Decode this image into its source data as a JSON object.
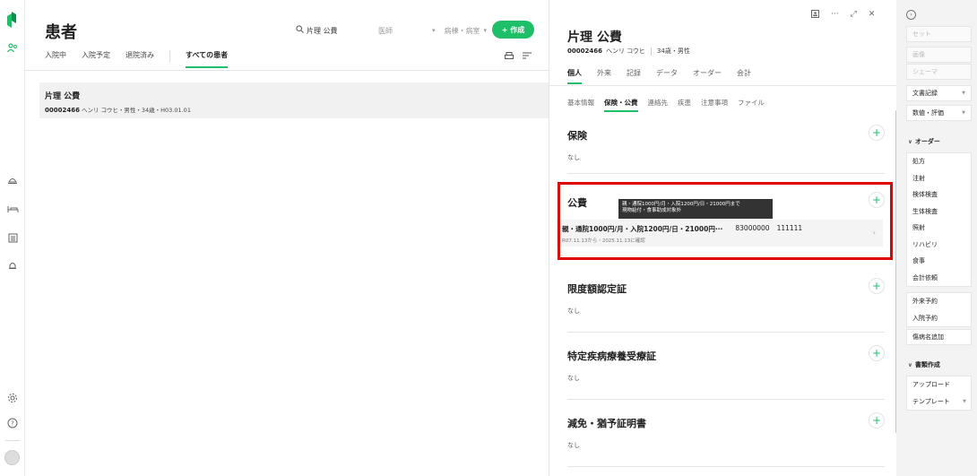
{
  "list": {
    "title": "患者",
    "search": {
      "query": "片理 公費",
      "filter_doctor": "医師",
      "filter_ward": "病棟・病室"
    },
    "create_label": "+ 作成",
    "tabs": [
      "入院中",
      "入院予定",
      "退院済み",
      "すべての患者"
    ],
    "active_tab": 3,
    "patient": {
      "name": "片理 公費",
      "id": "00002466",
      "meta": "ヘンリ コウヒ・男性・34歳・H03.01.01"
    }
  },
  "detail": {
    "name": "片理 公費",
    "id": "00002466",
    "kana": "ヘンリ コウヒ",
    "age_sex": "34歳・男性",
    "tabs": [
      "個人",
      "外来",
      "記録",
      "データ",
      "オーダー",
      "会計"
    ],
    "subtabs": [
      "基本情報",
      "保険・公費",
      "連絡先",
      "疾患",
      "注意事項",
      "ファイル"
    ],
    "sections": {
      "insurance": {
        "title": "保険",
        "value": "なし"
      },
      "public": {
        "title": "公費",
        "tooltip_line1": "親・通院1000円/月・入院1200円/日・21000円まで",
        "tooltip_line2": "現物給付・食事助成対象外",
        "item_main": "親・通院1000円/月・入院1200円/日・21000円···",
        "item_num1": "83000000",
        "item_num2": "111111",
        "item_date": "R07.11.13から・2025.11.13に確認"
      },
      "limit": {
        "title": "限度額認定証",
        "value": "なし"
      },
      "specific": {
        "title": "特定疾病療養受療証",
        "value": "なし"
      },
      "exemption": {
        "title": "減免・猶予証明書",
        "value": "なし"
      }
    }
  },
  "actions": {
    "set": "セット",
    "image": "画像",
    "schema": "シェーマ",
    "doc_record": "文書記録",
    "value_eval": "数値・評価",
    "order_header": "オーダー",
    "order_items": [
      "処方",
      "注射",
      "検体検査",
      "生体検査",
      "照射",
      "リハビリ",
      "食事",
      "会計依頼"
    ],
    "appointments": [
      "外来予約",
      "入院予約"
    ],
    "add_disease": "傷病名追加",
    "docs_header": "書類作成",
    "upload": "アップロード",
    "template": "テンプレート"
  },
  "colors": {
    "accent": "#1fbf6a",
    "highlight": "#e00000"
  }
}
